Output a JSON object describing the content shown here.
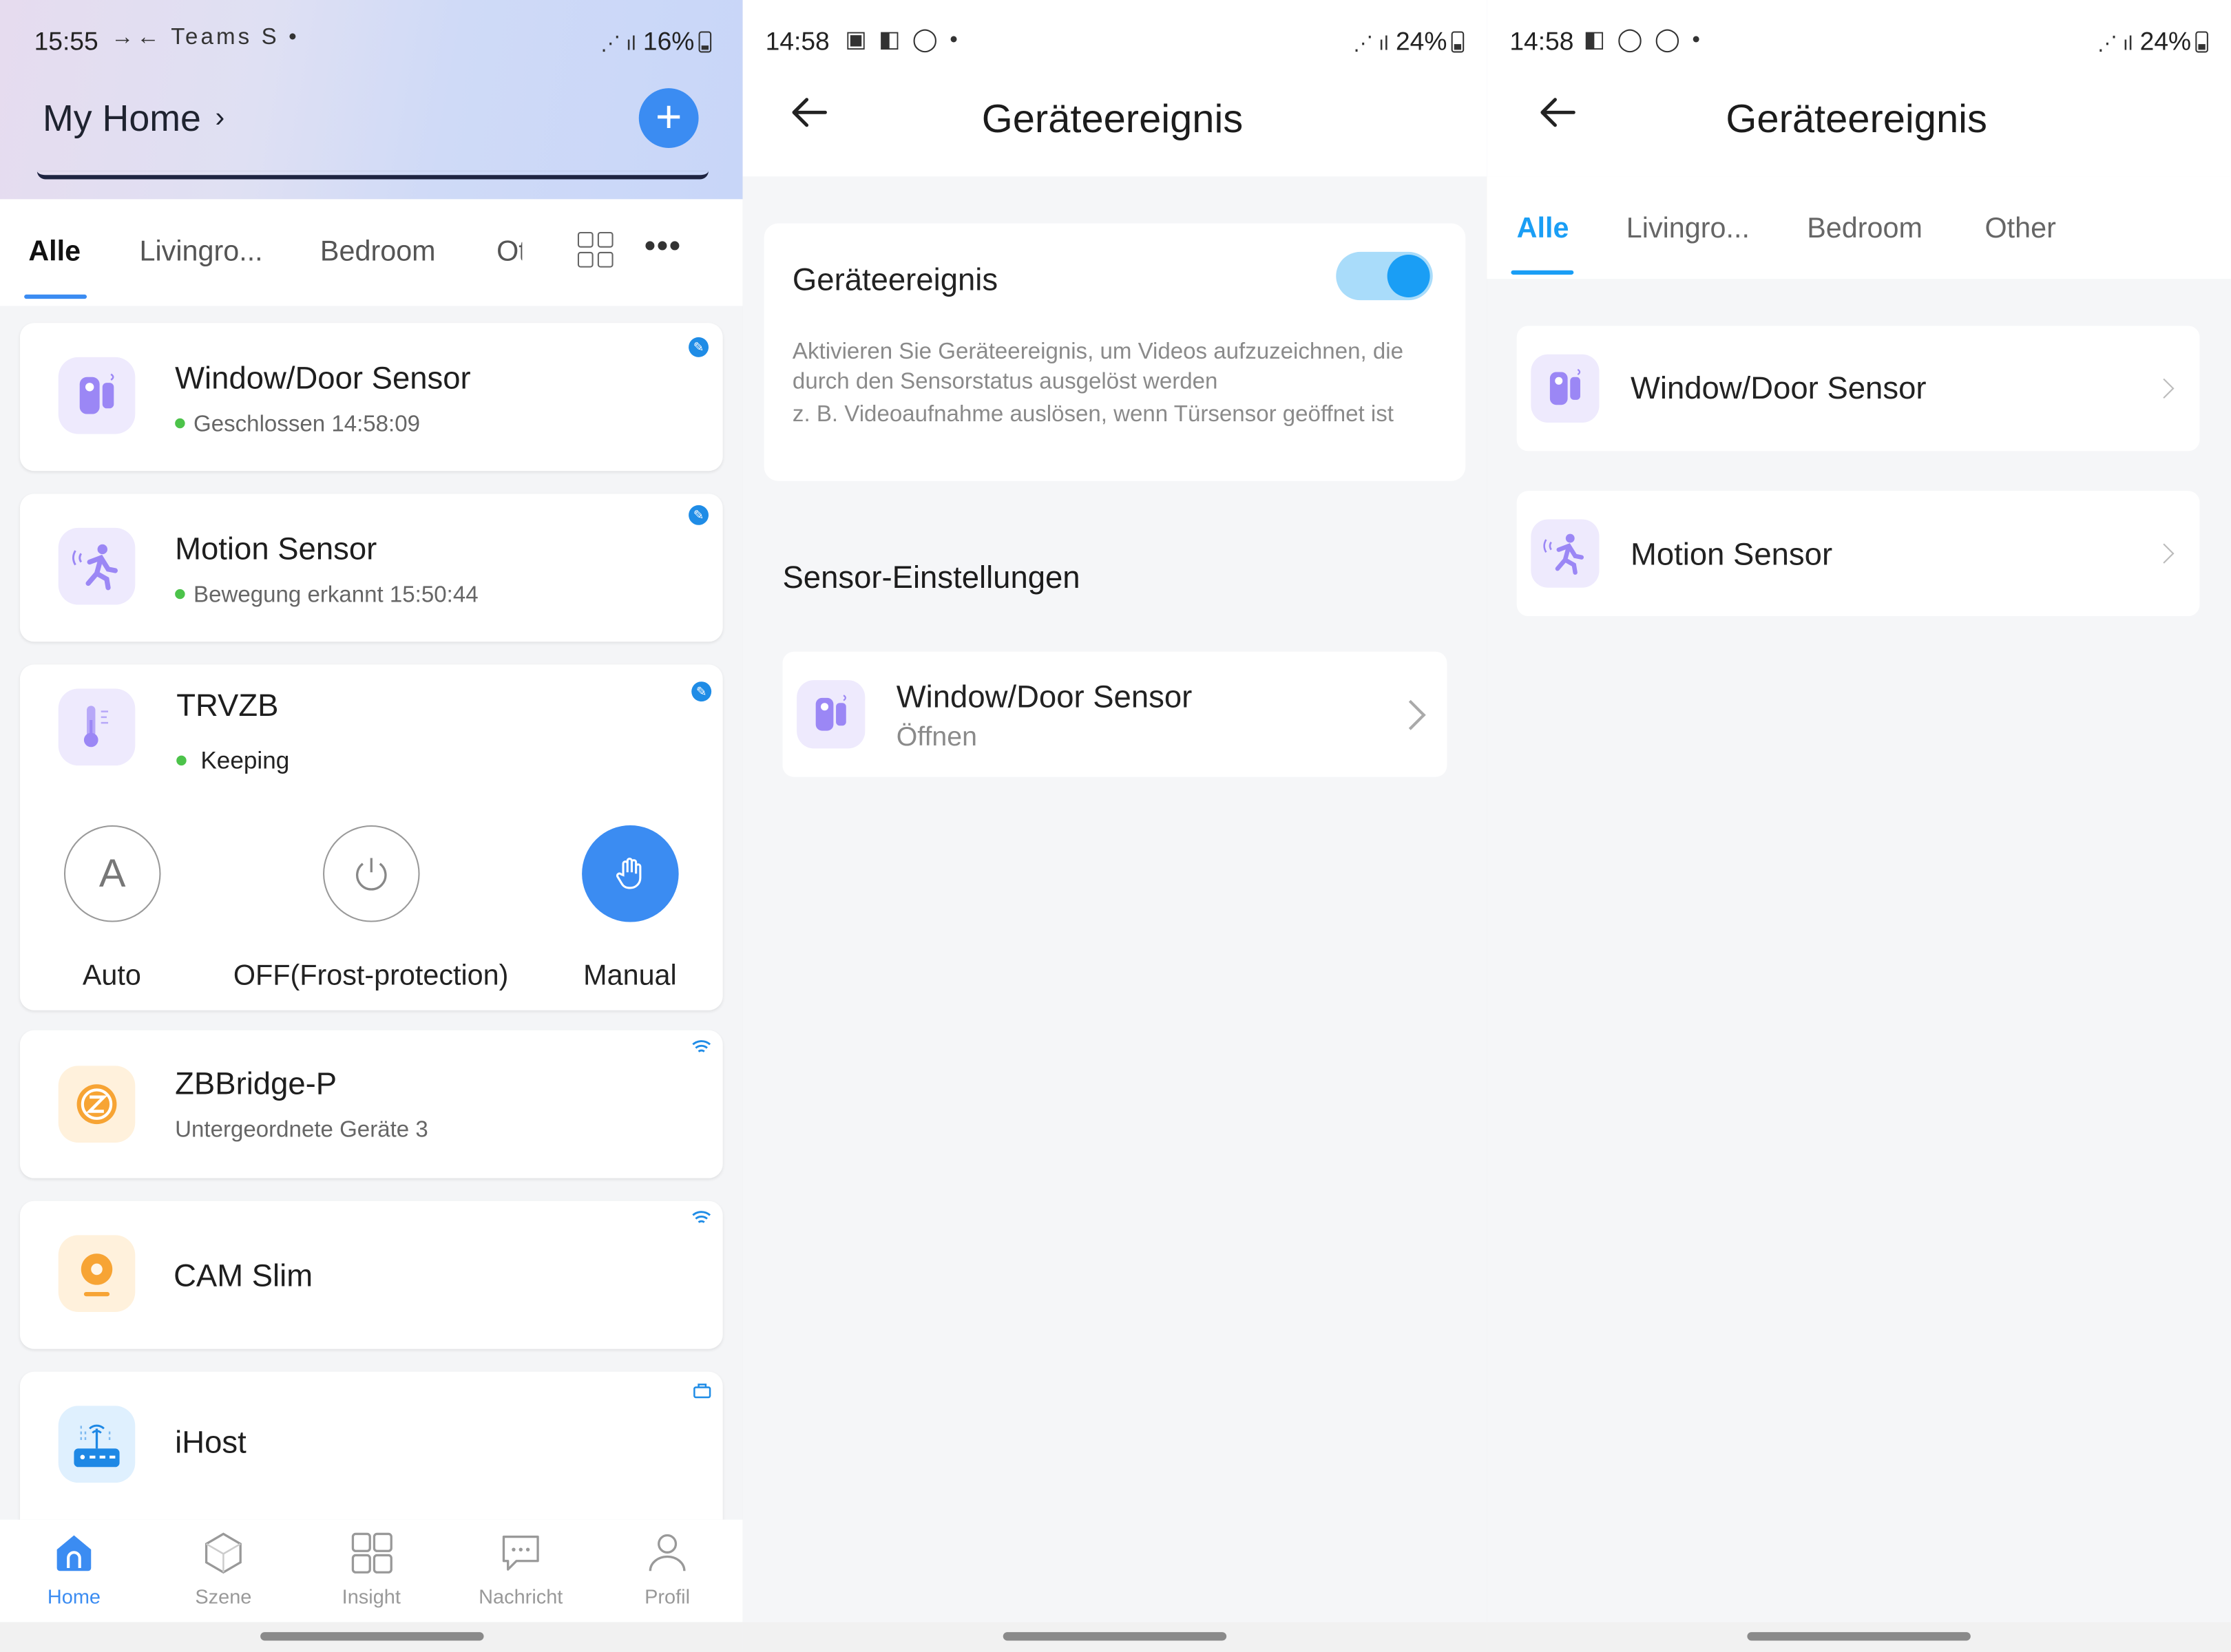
{
  "screen1": {
    "status": {
      "time": "15:55",
      "icons": "→← Teams S •",
      "battery": "16%"
    },
    "header": {
      "home_title": "My Home",
      "add_button": "+"
    },
    "tabs": [
      "Alle",
      "Livingro...",
      "Bedroom",
      "Ot"
    ],
    "devices": [
      {
        "name": "Window/Door Sensor",
        "status": "Geschlossen 14:58:09",
        "icon": "window-door-sensor-icon"
      },
      {
        "name": "Motion Sensor",
        "status": "Bewegung erkannt 15:50:44",
        "icon": "motion-sensor-icon"
      },
      {
        "name": "TRVZB",
        "status": "Keeping",
        "icon": "thermostat-icon"
      },
      {
        "name": "ZBBridge-P",
        "status": "Untergeordnete Geräte 3",
        "icon": "zigbee-bridge-icon"
      },
      {
        "name": "CAM Slim",
        "status": "",
        "icon": "camera-icon"
      },
      {
        "name": "iHost",
        "status": "",
        "icon": "hub-icon"
      }
    ],
    "modes": [
      {
        "label": "Auto",
        "glyph": "A"
      },
      {
        "label": "OFF(Frost-protection)",
        "glyph": ""
      },
      {
        "label": "Manual",
        "glyph": ""
      }
    ],
    "nav": [
      "Home",
      "Szene",
      "Insight",
      "Nachricht",
      "Profil"
    ]
  },
  "screen2": {
    "status": {
      "time": "14:58",
      "battery": "24%"
    },
    "title": "Geräteereignis",
    "event_card": {
      "title": "Geräteereignis",
      "toggle_on": true,
      "desc": "Aktivieren Sie Geräteereignis, um Videos aufzuzeichnen, die durch den Sensorstatus ausgelöst werden",
      "example": "z. B. Videoaufnahme auslösen, wenn Türsensor geöffnet ist"
    },
    "section_title": "Sensor-Einstellungen",
    "sensor_row": {
      "name": "Window/Door Sensor",
      "sub": "Öffnen"
    }
  },
  "screen3": {
    "status": {
      "time": "14:58",
      "battery": "24%"
    },
    "title": "Geräteereignis",
    "tabs": [
      "Alle",
      "Livingro...",
      "Bedroom",
      "Other"
    ],
    "rows": [
      {
        "name": "Window/Door Sensor"
      },
      {
        "name": "Motion Sensor"
      }
    ]
  },
  "colors": {
    "accent": "#3b8cf2",
    "toggle": "#1a9ef5",
    "status_green": "#4cc34a"
  }
}
